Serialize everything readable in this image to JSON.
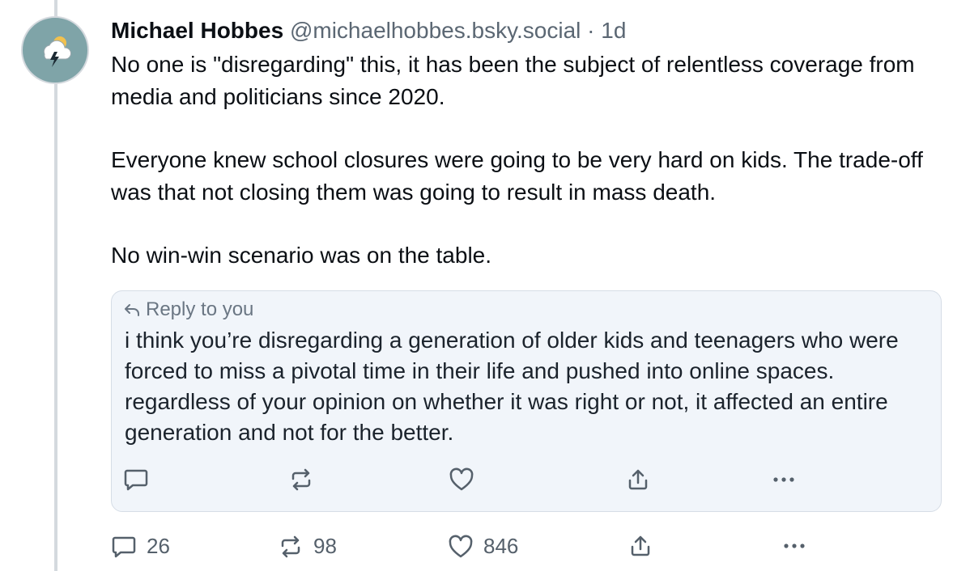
{
  "post": {
    "author_name": "Michael Hobbes",
    "handle": "@michaelhobbes.bsky.social",
    "separator": "·",
    "age": "1d",
    "paragraphs": [
      "No one is \"disregarding\" this, it has been the subject of relentless coverage from media and politicians since 2020.",
      "Everyone knew school closures were going to be very hard on kids. The trade-off was that not closing them was going to result in mass death.",
      "No win-win scenario was on the table."
    ],
    "avatar_icon": "storm-cloud-icon"
  },
  "quote": {
    "reply_label": "Reply to you",
    "text": "i think you’re disregarding a generation of older kids and teenagers who were forced to miss a pivotal time in their life and pushed into online spaces. regardless of your opinion on whether it was right or not, it affected an entire generation and not for the better."
  },
  "actions": {
    "replies": "26",
    "reposts": "98",
    "likes": "846"
  },
  "colors": {
    "accent": "#7fa4a8",
    "muted_text": "#5b6773",
    "quote_background": "#f1f5fa",
    "thread_line": "#d4d9de"
  }
}
